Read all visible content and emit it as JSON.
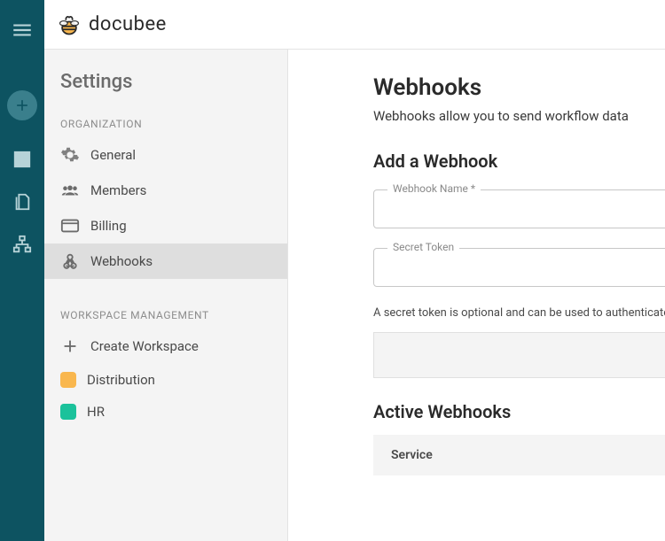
{
  "brand": {
    "name": "docubee"
  },
  "sidebar": {
    "title": "Settings",
    "sections": [
      {
        "label": "ORGANIZATION",
        "items": [
          {
            "label": "General"
          },
          {
            "label": "Members"
          },
          {
            "label": "Billing"
          },
          {
            "label": "Webhooks"
          }
        ]
      },
      {
        "label": "WORKSPACE MANAGEMENT",
        "items": [
          {
            "label": "Create Workspace"
          },
          {
            "label": "Distribution",
            "color": "#f9b74e"
          },
          {
            "label": "HR",
            "color": "#1bc29b"
          }
        ]
      }
    ]
  },
  "main": {
    "heading": "Webhooks",
    "subheading": "Webhooks allow you to send workflow data",
    "form_heading": "Add a Webhook",
    "field_name_label": "Webhook Name *",
    "field_token_label": "Secret Token",
    "helper": "A secret token is optional and can be used to authenticate",
    "active_heading": "Active Webhooks",
    "table_col_service": "Service"
  }
}
